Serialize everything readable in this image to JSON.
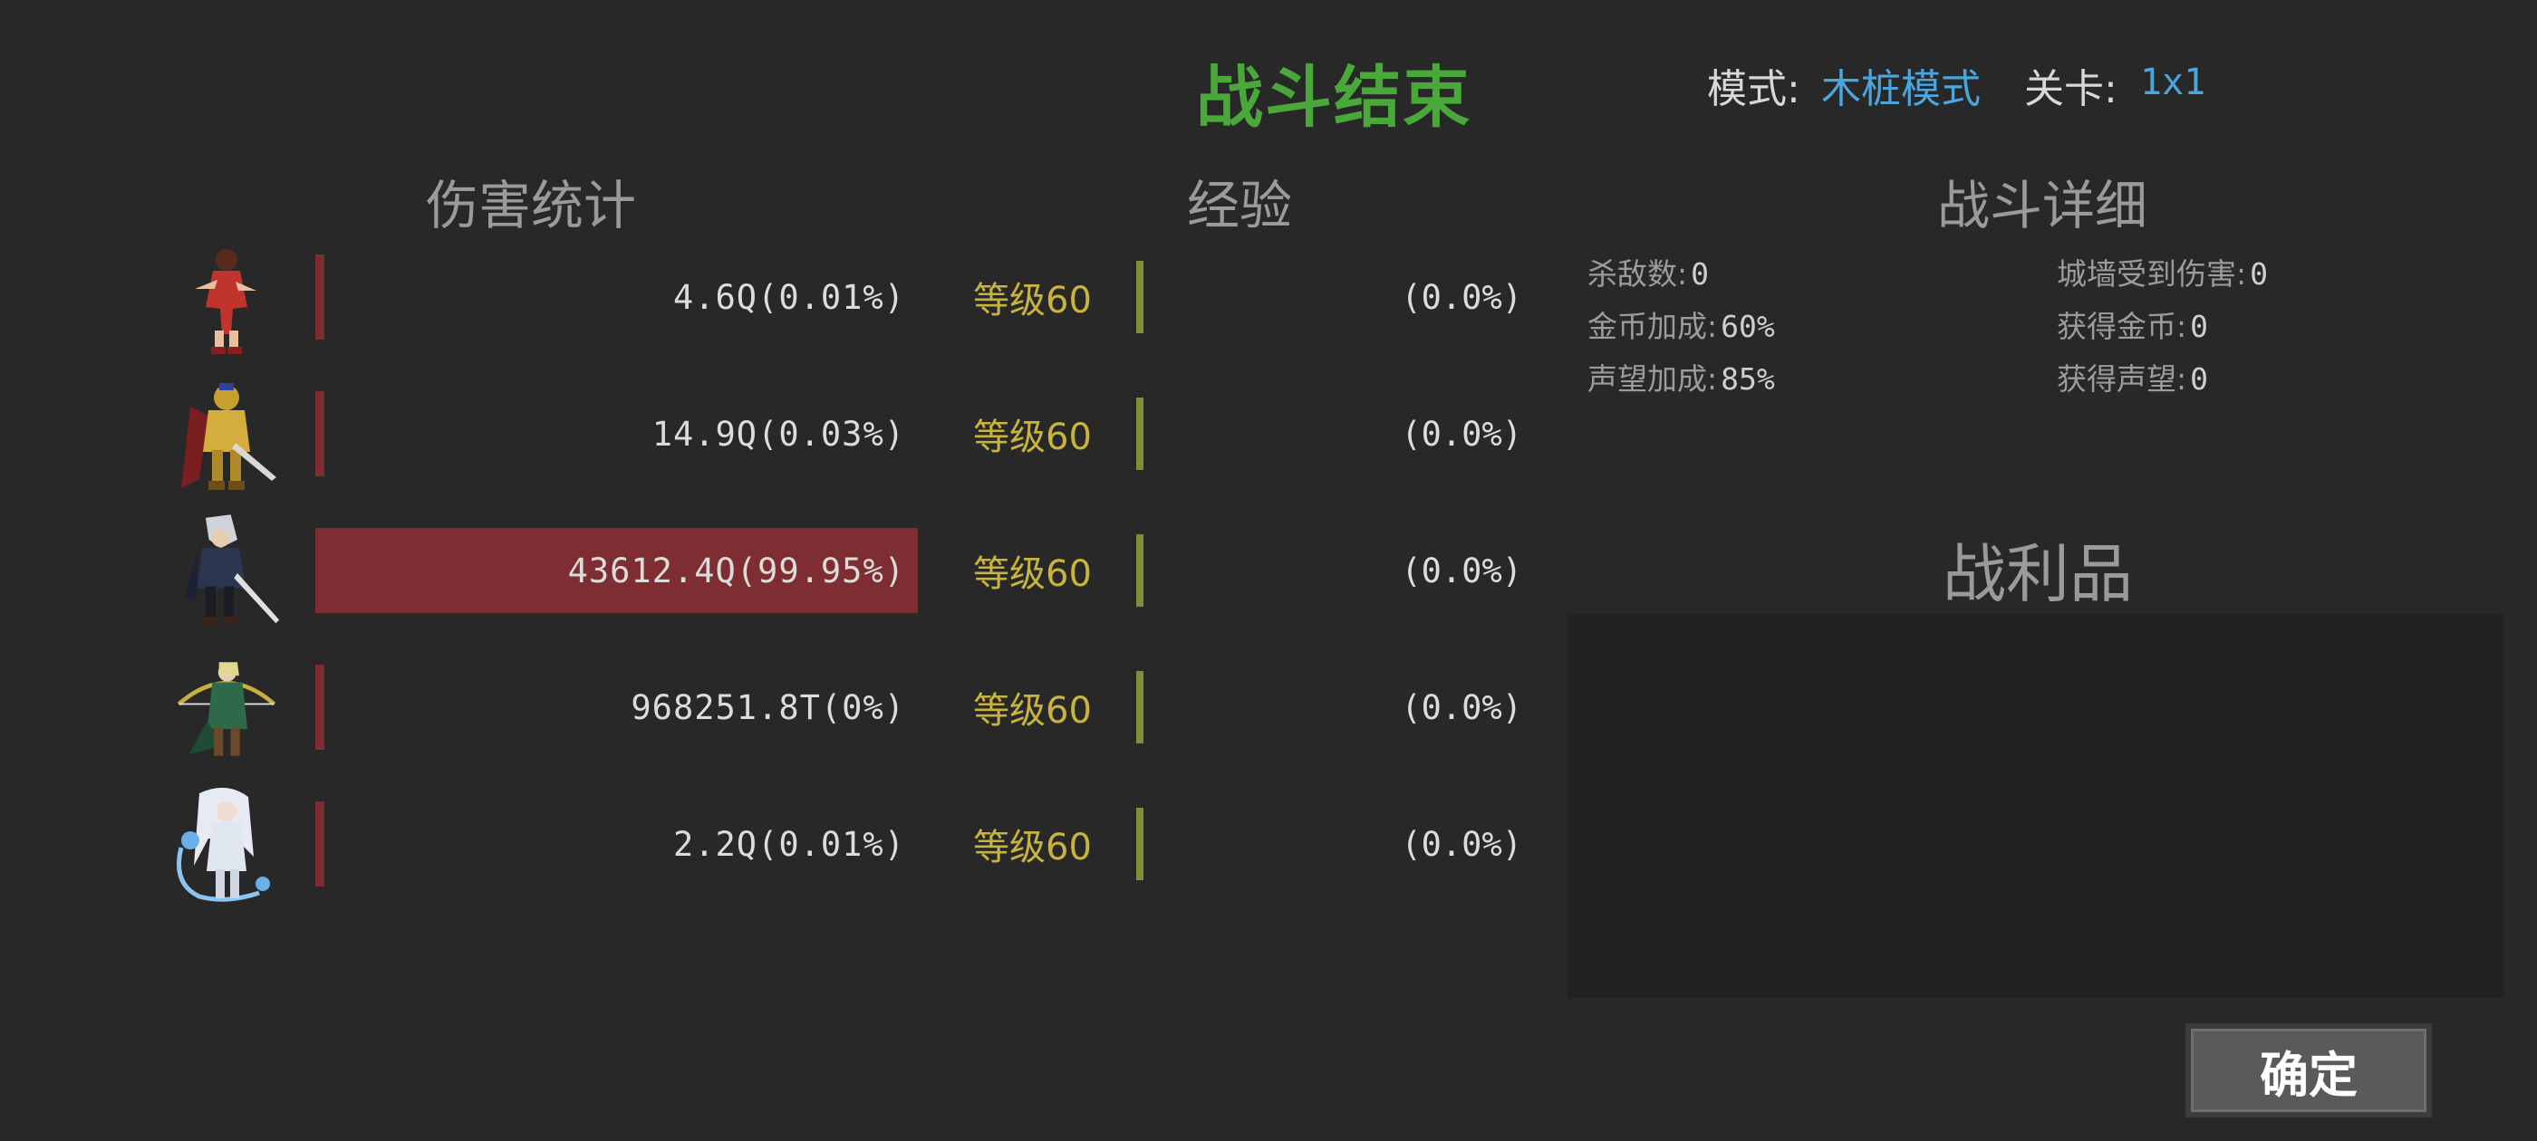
{
  "header": {
    "title": "战斗结束",
    "mode_label": "模式:",
    "mode_value": "木桩模式",
    "stage_label": "关卡:",
    "stage_value": "1x1"
  },
  "sections": {
    "damage": "伤害统计",
    "exp": "经验",
    "details": "战斗详细",
    "loot": "战利品"
  },
  "heroes": [
    {
      "portrait": "red-warrior-woman",
      "damage": "4.6Q(0.01%)",
      "damage_share": 0.0001,
      "level": "等级60",
      "exp": "(0.0%)",
      "exp_share": 0.0
    },
    {
      "portrait": "golden-armored-knight",
      "damage": "14.9Q(0.03%)",
      "damage_share": 0.0003,
      "level": "等级60",
      "exp": "(0.0%)",
      "exp_share": 0.0
    },
    {
      "portrait": "silver-haired-swordsman",
      "damage": "43612.4Q(99.95%)",
      "damage_share": 0.9995,
      "level": "等级60",
      "exp": "(0.0%)",
      "exp_share": 0.0
    },
    {
      "portrait": "elf-archer",
      "damage": "968251.8T(0%)",
      "damage_share": 0.0,
      "level": "等级60",
      "exp": "(0.0%)",
      "exp_share": 0.0
    },
    {
      "portrait": "ice-mage-woman",
      "damage": "2.2Q(0.01%)",
      "damage_share": 0.0001,
      "level": "等级60",
      "exp": "(0.0%)",
      "exp_share": 0.0
    }
  ],
  "details": [
    {
      "label": "杀敌数:",
      "value": "0"
    },
    {
      "label": "城墙受到伤害:",
      "value": "0"
    },
    {
      "label": "金币加成:",
      "value": "60%"
    },
    {
      "label": "获得金币:",
      "value": "0"
    },
    {
      "label": "声望加成:",
      "value": "85%"
    },
    {
      "label": "获得声望:",
      "value": "0"
    }
  ],
  "confirm_label": "确定",
  "colors": {
    "background": "#282828",
    "title": "#4aa83a",
    "link": "#4aa6dc",
    "damage_bar": "#7e2e32",
    "exp_bar": "#7f8f38",
    "level_text": "#c8b43c"
  }
}
